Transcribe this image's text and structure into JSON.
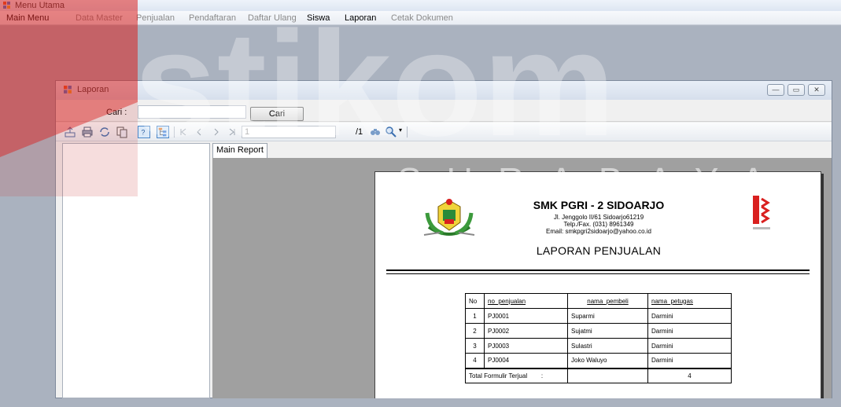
{
  "main_window": {
    "title": "Menu Utama"
  },
  "menu": {
    "items": [
      {
        "label": "Main Menu",
        "enabled": true
      },
      {
        "label": "Data Master",
        "enabled": false
      },
      {
        "label": "Penjualan",
        "enabled": false
      },
      {
        "label": "Pendaftaran",
        "enabled": false
      },
      {
        "label": "Daftar Ulang",
        "enabled": false
      },
      {
        "label": "Siswa",
        "enabled": true
      },
      {
        "label": "Laporan",
        "enabled": true
      },
      {
        "label": "Cetak Dokumen",
        "enabled": false
      }
    ]
  },
  "watermark": {
    "brand": "stikom",
    "city": "SURABAYA"
  },
  "child_window": {
    "title": "Laporan",
    "search": {
      "label": "Cari :",
      "value": "",
      "button_label": "Cari"
    }
  },
  "toolbar": {
    "icons": [
      "export-icon",
      "print-icon",
      "refresh-icon",
      "copy-icon",
      "help-icon",
      "group-tree-icon",
      "first-page-icon",
      "prev-page-icon",
      "next-page-icon",
      "last-page-icon",
      "find-icon",
      "zoom-icon"
    ],
    "page_value": "1",
    "page_total": "/1"
  },
  "report_tab": {
    "label": "Main Report"
  },
  "report": {
    "school_name": "SMK PGRI - 2 SIDOARJO",
    "address_lines": [
      "Jl. Jenggolo II/61 Sidoarjo61219",
      "Telp./Fax. (031) 8961349",
      "Email: smkpgri2sidoarjo@yahoo.co.id"
    ],
    "title": "LAPORAN PENJUALAN",
    "columns": [
      "No",
      "no_penjualan",
      "nama_pembeli",
      "nama_petugas"
    ],
    "rows": [
      {
        "no": "1",
        "no_penjualan": "PJ0001",
        "nama_pembeli": "Suparmi",
        "nama_petugas": "Darmini"
      },
      {
        "no": "2",
        "no_penjualan": "PJ0002",
        "nama_pembeli": "Sujatmi",
        "nama_petugas": "Darmini"
      },
      {
        "no": "3",
        "no_penjualan": "PJ0003",
        "nama_pembeli": "Sulastri",
        "nama_petugas": "Darmini"
      },
      {
        "no": "4",
        "no_penjualan": "PJ0004",
        "nama_pembeli": "Joko Waluyo",
        "nama_petugas": "Darmini"
      }
    ],
    "total_label": "Total Formulir Terjual",
    "total_sep": ":",
    "total_value": "4"
  },
  "colors": {
    "accent_red": "#d9201f",
    "window_chrome": "#dde6f2"
  }
}
